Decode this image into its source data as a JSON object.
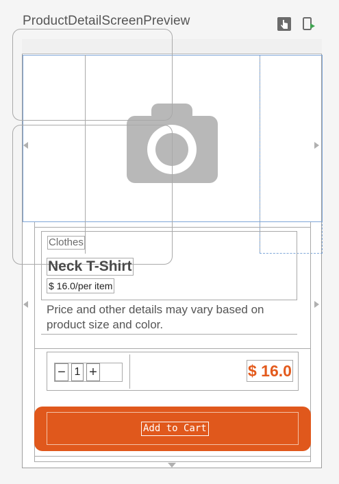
{
  "preview": {
    "title": "ProductDetailScreenPreview",
    "actions": [
      "interactive-mode-icon",
      "deploy-to-device-icon"
    ]
  },
  "image": {
    "icon": "camera-icon"
  },
  "product": {
    "category": "Clothes",
    "name": "Neck T-Shirt",
    "unit_price": "$ 16.0/per item",
    "note": "Price and other details may vary based on product size and color."
  },
  "quantity": {
    "decrement_label": "−",
    "value": "1",
    "increment_label": "+"
  },
  "total_price": "$ 16.0",
  "add_to_cart_label": "Add to Cart",
  "colors": {
    "accent": "#e0581c",
    "price": "#e35a1c",
    "placeholder": "#b8b8b8"
  }
}
